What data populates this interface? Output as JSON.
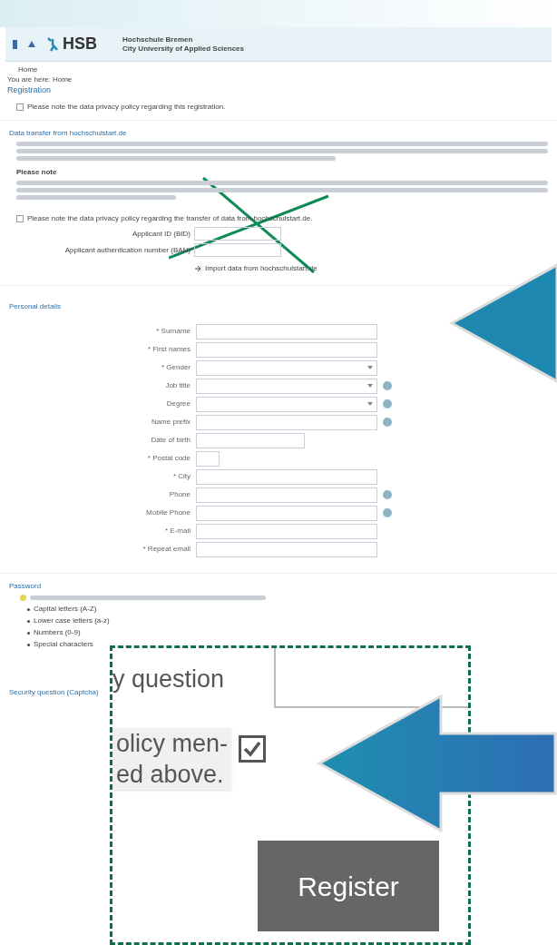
{
  "header": {
    "logo": "HSB",
    "org_lines": [
      "Hochschule Bremen",
      "City University of Applied Sciences"
    ]
  },
  "breadcrumb": {
    "top": "Home",
    "trail": "You are here: Home"
  },
  "page_title": "Registration",
  "privacy_note": "Please note the data privacy policy regarding this registration.",
  "privacy_checked": false,
  "data_transfer": {
    "title": "Data transfer from hochschulstart.de",
    "note_title": "Please note",
    "privacy_note": "Please note the data privacy policy regarding the transfer of data from hochschulstart.de.",
    "privacy_checked": false,
    "fields": [
      {
        "label": "Applicant ID (BID)"
      },
      {
        "label": "Applicant authentication number (BAN)"
      }
    ],
    "import_link": "Import data from hochschulstart.de"
  },
  "personal": {
    "title": "Personal details",
    "fields": [
      {
        "label": "* Surname",
        "kind": "text",
        "info": false
      },
      {
        "label": "* First names",
        "kind": "text",
        "info": false
      },
      {
        "label": "* Gender",
        "kind": "select",
        "info": false
      },
      {
        "label": "Job title",
        "kind": "select",
        "info": true
      },
      {
        "label": "Degree",
        "kind": "select",
        "info": true
      },
      {
        "label": "Name prefix",
        "kind": "text",
        "info": true
      },
      {
        "label": "Date of birth",
        "kind": "date",
        "info": false
      },
      {
        "label": "* Postal code",
        "kind": "short",
        "info": false
      },
      {
        "label": "* City",
        "kind": "text",
        "info": false
      },
      {
        "label": "Phone",
        "kind": "text",
        "info": true
      },
      {
        "label": "Mobile Phone",
        "kind": "text",
        "info": true
      },
      {
        "label": "* E-mail",
        "kind": "text",
        "info": false
      },
      {
        "label": "* Repeat email",
        "kind": "text",
        "info": false
      }
    ]
  },
  "password": {
    "title": "Password",
    "rules": [
      "Capital letters (A-Z)",
      "Lower case letters (a-z)",
      "Numbers (0-9)",
      "Special characters"
    ]
  },
  "security": {
    "title": "Security question (Captcha)"
  },
  "inset": {
    "question_label": "y question",
    "consent_lines": [
      "olicy men-",
      "ed above."
    ],
    "consent_checked": true,
    "register": "Register"
  }
}
